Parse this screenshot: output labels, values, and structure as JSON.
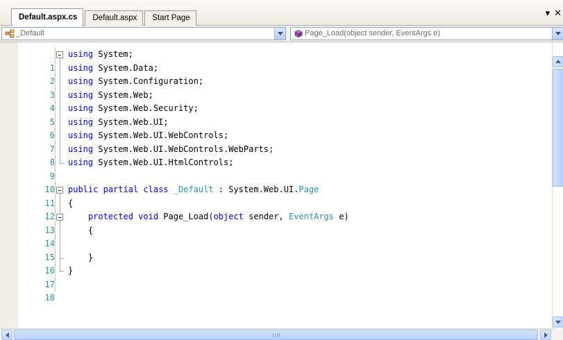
{
  "tabs": [
    {
      "label": "Default.aspx.cs",
      "active": true
    },
    {
      "label": "Default.aspx",
      "active": false
    },
    {
      "label": "Start Page",
      "active": false
    }
  ],
  "tab_controls": {
    "dropdown_icon": "▾",
    "close_icon": "✕"
  },
  "navbar": {
    "class_combo": {
      "value": "_Default",
      "icon": "class-icon"
    },
    "member_combo": {
      "value": "Page_Load(object sender, EventArgs e)",
      "icon": "method-icon"
    }
  },
  "editor": {
    "lines": [
      {
        "n": "1",
        "code": "using System;"
      },
      {
        "n": "2",
        "code": "using System.Data;"
      },
      {
        "n": "3",
        "code": "using System.Configuration;"
      },
      {
        "n": "4",
        "code": "using System.Web;"
      },
      {
        "n": "5",
        "code": "using System.Web.Security;"
      },
      {
        "n": "6",
        "code": "using System.Web.UI;"
      },
      {
        "n": "7",
        "code": "using System.Web.UI.WebControls;"
      },
      {
        "n": "8",
        "code": "using System.Web.UI.WebControls.WebParts;"
      },
      {
        "n": "9",
        "code": "using System.Web.UI.HtmlControls;"
      },
      {
        "n": "10",
        "code": ""
      },
      {
        "n": "11",
        "code": "public partial class _Default : System.Web.UI.Page"
      },
      {
        "n": "12",
        "code": "{"
      },
      {
        "n": "13",
        "code": "    protected void Page_Load(object sender, EventArgs e)"
      },
      {
        "n": "14",
        "code": "    {"
      },
      {
        "n": "15",
        "code": ""
      },
      {
        "n": "16",
        "code": "    }"
      },
      {
        "n": "17",
        "code": "}"
      },
      {
        "n": "18",
        "code": ""
      }
    ]
  },
  "colors": {
    "keyword": "#0000ff",
    "type": "#2b91af",
    "line_number": "#2b91af",
    "text": "#000000"
  }
}
